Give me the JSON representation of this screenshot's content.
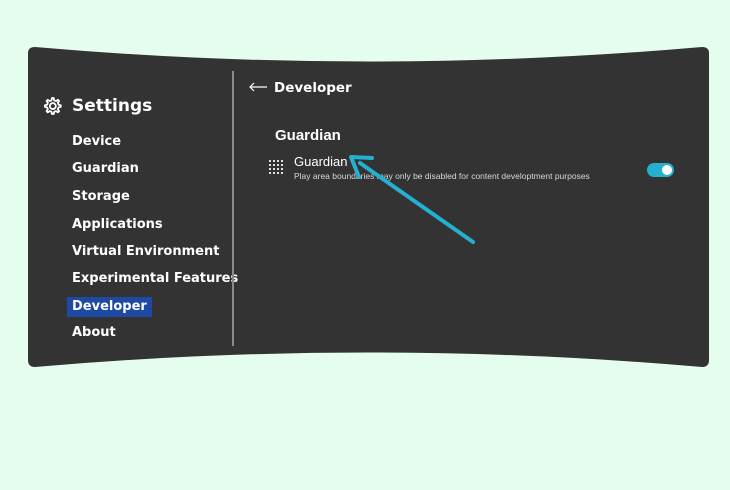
{
  "sidebar": {
    "title": "Settings",
    "title_icon": "gear-icon",
    "items": [
      {
        "label": "Device",
        "active": false
      },
      {
        "label": "Guardian",
        "active": false
      },
      {
        "label": "Storage",
        "active": false
      },
      {
        "label": "Applications",
        "active": false
      },
      {
        "label": "Virtual Environment",
        "active": false
      },
      {
        "label": "Experimental Features",
        "active": false
      },
      {
        "label": "Developer",
        "active": true
      },
      {
        "label": "About",
        "active": false
      }
    ]
  },
  "header": {
    "back_icon": "back-arrow-icon",
    "title": "Developer"
  },
  "section": {
    "title": "Guardian",
    "setting": {
      "icon": "grid-dots-icon",
      "title": "Guardian",
      "description": "Play area boundaries may only be disabled for content developtment purposes",
      "toggle_on": true
    }
  },
  "colors": {
    "background": "#e5fdef",
    "panel": "#333333",
    "active_item": "#1f4aa4",
    "toggle": "#25b0d0",
    "annotation_arrow": "#25b0d0"
  }
}
